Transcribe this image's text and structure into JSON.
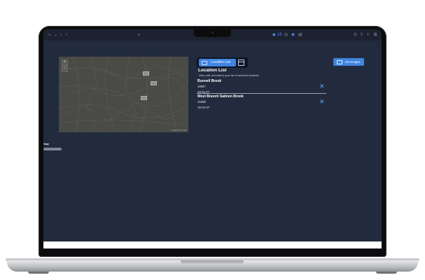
{
  "browser": {
    "sidebar_icon": "sidebar-icon",
    "back_icon": "chevron-left-icon",
    "forward_icon": "chevron-right-icon",
    "address_text": "",
    "extension_badge": "15"
  },
  "map": {
    "zoom_in": "+",
    "zoom_out": "−",
    "attribution": "© Leaflet | Tiles © Esri"
  },
  "location_tab": {
    "label": "Location List",
    "icon": "list-icon"
  },
  "calendar_icon": "calendar-icon",
  "get_images": {
    "label": "Get Images",
    "icon": "image-icon"
  },
  "location_list": {
    "title": "Location List",
    "subtitle": "View, edit, and add to your list of selected locations"
  },
  "entries": [
    {
      "name": "Bunnell Brook",
      "id": "19657",
      "date": "19-01-07"
    },
    {
      "name": "West Branch Salmon Brook",
      "id": "15499",
      "date": "19-01-07"
    }
  ],
  "year": {
    "label": "Year"
  },
  "colors": {
    "page_bg": "#222b3d",
    "accent": "#3f84e0",
    "remove_x": "#5aa2ff"
  }
}
